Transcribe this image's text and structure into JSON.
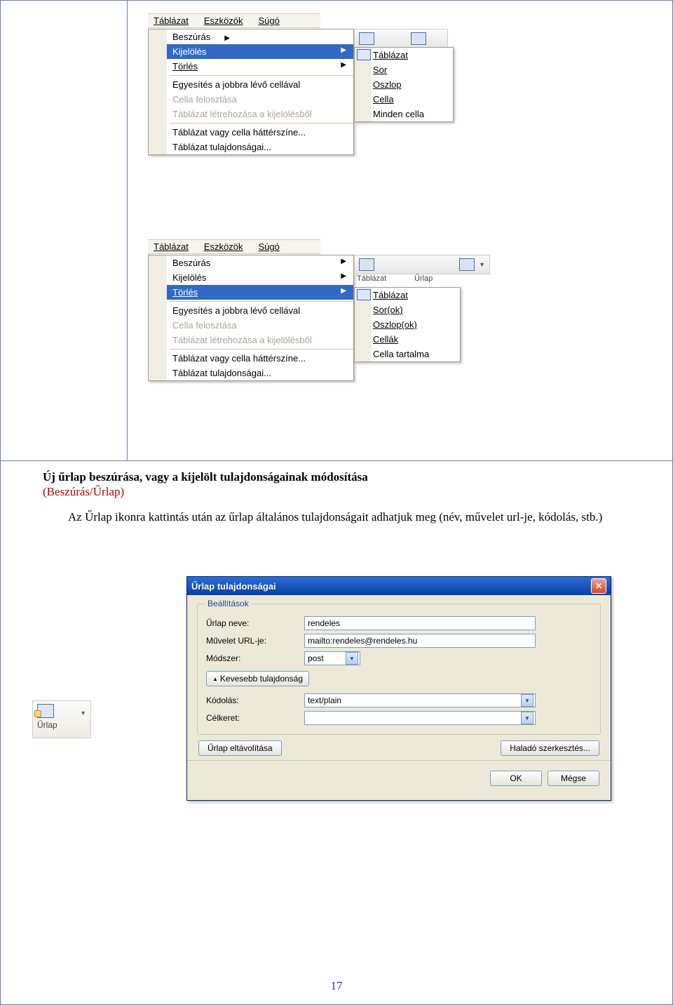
{
  "menubar": {
    "tablazat": "Táblázat",
    "eszkozok": "Eszközök",
    "sugo": "Súgó"
  },
  "menu1": {
    "beszuras": "Beszúrás",
    "kijeloles": "Kijelölés",
    "torles": "Törlés",
    "egyesites": "Egyesítés a jobbra lévő cellával",
    "cellafel": "Cella felosztása",
    "letrehoz": "Táblázat létrehozása a kijelölésből",
    "hatszin": "Táblázat vagy cella háttérszíne...",
    "tulajd": "Táblázat tulajdonságai..."
  },
  "sub1": {
    "tablazat": "Táblázat",
    "sor": "Sor",
    "oszlop": "Oszlop",
    "cella": "Cella",
    "minden": "Minden cella"
  },
  "sub2toolbar": {
    "tablazat": "Táblázat",
    "urlap": "Űrlap"
  },
  "sub2": {
    "tablazat": "Táblázat",
    "sorok": "Sor(ok)",
    "oszlopok": "Oszlop(ok)",
    "cellak": "Cellák",
    "tartalma": "Cella tartalma"
  },
  "text": {
    "line1a": "Új űrlap beszúrása, vagy a kijelölt tulajdonságainak módosítása",
    "line1b": "(Beszúrás/Űrlap)",
    "line2": "Az Űrlap ikonra kattintás után az űrlap általános tulajdonságait adhatjuk meg (név, művelet url-je, kódolás, stb.)"
  },
  "toolbarBtn": {
    "label": "Űrlap"
  },
  "dialog": {
    "title": "Űrlap tulajdonságai",
    "legend": "Beállítások",
    "labels": {
      "nev": "Űrlap neve:",
      "url": "Művelet URL-je:",
      "modszer": "Módszer:",
      "kodolas": "Kódolás:",
      "celkeret": "Célkeret:"
    },
    "values": {
      "nev": "rendeles",
      "url": "mailto:rendeles@rendeles.hu",
      "modszer": "post",
      "kodolas": "text/plain",
      "celkeret": ""
    },
    "buttons": {
      "kevesebb": "Kevesebb tulajdonság",
      "eltavolit": "Űrlap eltávolítása",
      "halado": "Haladó szerkesztés...",
      "ok": "OK",
      "megse": "Mégse"
    }
  },
  "pagenum": "17"
}
